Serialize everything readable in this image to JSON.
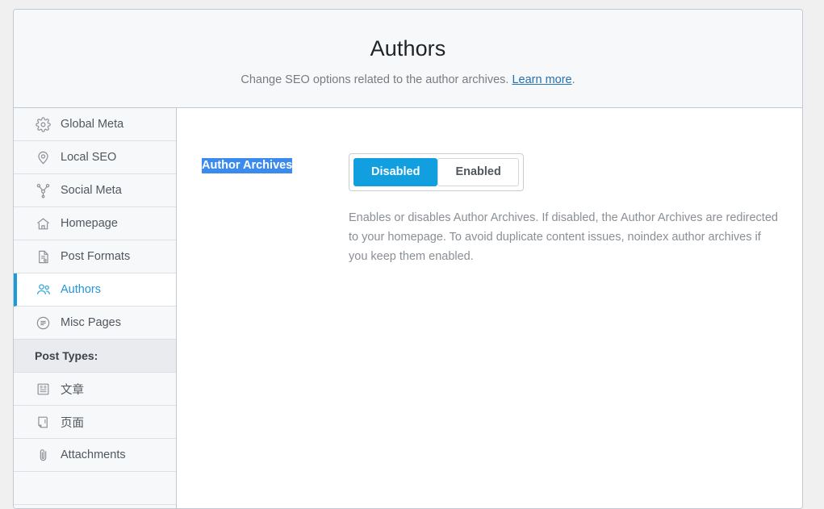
{
  "header": {
    "title": "Authors",
    "subtitle_before": "Change SEO options related to the author archives. ",
    "subtitle_link": "Learn more",
    "subtitle_after": "."
  },
  "sidebar": {
    "items": [
      {
        "label": "Global Meta",
        "icon": "gear-icon",
        "active": false
      },
      {
        "label": "Local SEO",
        "icon": "map-pin-icon",
        "active": false
      },
      {
        "label": "Social Meta",
        "icon": "share-network-icon",
        "active": false
      },
      {
        "label": "Homepage",
        "icon": "home-icon",
        "active": false
      },
      {
        "label": "Post Formats",
        "icon": "document-icon",
        "active": false
      },
      {
        "label": "Authors",
        "icon": "users-icon",
        "active": true
      },
      {
        "label": "Misc Pages",
        "icon": "list-circle-icon",
        "active": false
      }
    ],
    "group_heading": "Post Types:",
    "post_type_items": [
      {
        "label": "文章",
        "icon": "newspaper-icon"
      },
      {
        "label": "页面",
        "icon": "page-icon"
      },
      {
        "label": "Attachments",
        "icon": "paperclip-icon"
      }
    ]
  },
  "main": {
    "setting": {
      "label": "Author Archives",
      "options": [
        {
          "label": "Disabled",
          "selected": true
        },
        {
          "label": "Enabled",
          "selected": false
        }
      ],
      "description": "Enables or disables Author Archives. If disabled, the Author Archives are redirected to your homepage. To avoid duplicate content issues, noindex author archives if you keep them enabled."
    }
  },
  "colors": {
    "accent": "#119fdf",
    "link": "#2271b1",
    "selection": "#3b8bee",
    "active_nav_text": "#2196d8"
  }
}
